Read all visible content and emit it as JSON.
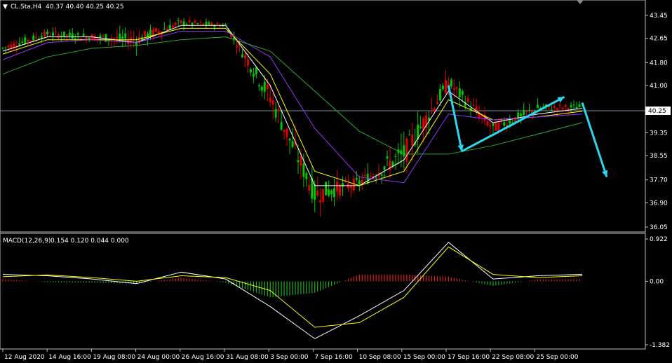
{
  "header": {
    "symbol": "CL.Sta,H4",
    "ohlc": "40.37 40.40 40.25 40.25",
    "macd_label": "MACD(12,26,9)",
    "macd_values": "0.154 0.120 0.044 0.000"
  },
  "price_axis": {
    "ticks": [
      "43.45",
      "42.65",
      "41.80",
      "41.00",
      "40.15",
      "39.35",
      "38.55",
      "37.70",
      "36.90",
      "36.05"
    ],
    "current_price_label": "40.25"
  },
  "macd_axis": {
    "ticks": [
      "0.922",
      "0.00",
      "-1.382"
    ]
  },
  "time_axis": {
    "labels": [
      "12 Aug 2020",
      "14 Aug 16:00",
      "19 Aug 08:00",
      "24 Aug 00:00",
      "26 Aug 16:00",
      "31 Aug 08:00",
      "3 Sep 00:00",
      "7 Sep 16:00",
      "10 Sep 08:00",
      "15 Sep 00:00",
      "17 Sep 16:00",
      "22 Sep 08:00",
      "25 Sep 00:00"
    ]
  },
  "colors": {
    "background": "#000000",
    "grid_border": "#c0c0c0",
    "bull_candle": "#00c800",
    "bear_candle": "#e00000",
    "ma_fast": "#ffffff",
    "ma_yellow": "#ffff00",
    "ma_purple": "#9933ff",
    "ma_slow": "#33aa33",
    "arrow": "#2ad8ee",
    "macd_hist_pos": "#e02020",
    "macd_hist_neg": "#20b020",
    "price_line": "#7f8fa6"
  },
  "chart_data": [
    {
      "type": "candlestick",
      "title": "CL.Sta,H4",
      "y_axis_range": [
        36.05,
        43.45
      ],
      "current_price": 40.25,
      "x": [
        "12 Aug 2020",
        "14 Aug 16:00",
        "19 Aug 08:00",
        "24 Aug 00:00",
        "26 Aug 16:00",
        "31 Aug 08:00",
        "3 Sep 00:00",
        "7 Sep 16:00",
        "10 Sep 08:00",
        "15 Sep 00:00",
        "17 Sep 16:00",
        "22 Sep 08:00",
        "25 Sep 00:00",
        "28 Sep"
      ],
      "close": [
        42.3,
        42.8,
        42.7,
        42.6,
        43.2,
        43.1,
        40.6,
        37.2,
        37.6,
        38.6,
        41.1,
        39.5,
        40.2,
        40.25
      ],
      "high": [
        42.8,
        43.1,
        43.0,
        43.2,
        43.6,
        43.3,
        42.0,
        39.2,
        38.3,
        40.3,
        41.6,
        40.4,
        40.6,
        40.7
      ],
      "low": [
        41.6,
        42.1,
        41.9,
        41.4,
        42.6,
        42.7,
        39.0,
        36.2,
        36.8,
        37.0,
        39.6,
        38.8,
        39.4,
        39.8
      ],
      "moving_averages": [
        {
          "name": "fast",
          "color": "#ffffff",
          "values": [
            42.2,
            42.7,
            42.7,
            42.5,
            43.1,
            43.1,
            41.0,
            37.5,
            37.5,
            38.4,
            40.8,
            39.7,
            40.0,
            40.2
          ]
        },
        {
          "name": "medium",
          "color": "#ffff00",
          "values": [
            42.1,
            42.6,
            42.6,
            42.6,
            43.0,
            43.0,
            41.4,
            38.0,
            37.5,
            38.0,
            40.5,
            39.8,
            39.9,
            40.1
          ]
        },
        {
          "name": "slow",
          "color": "#9933ff",
          "values": [
            41.9,
            42.5,
            42.6,
            42.5,
            42.9,
            42.9,
            42.0,
            39.5,
            37.8,
            37.6,
            40.0,
            39.8,
            39.9,
            40.0
          ]
        },
        {
          "name": "long",
          "color": "#33aa33",
          "values": [
            41.4,
            42.0,
            42.3,
            42.4,
            42.6,
            42.7,
            42.2,
            40.8,
            39.4,
            38.6,
            38.6,
            38.9,
            39.3,
            39.7
          ]
        }
      ],
      "annotations": [
        {
          "type": "arrow",
          "from": [
            "17 Sep 16:00",
            41.0
          ],
          "to": [
            "22 Sep 00:00",
            38.7
          ]
        },
        {
          "type": "arrow",
          "from": [
            "22 Sep 00:00",
            38.7
          ],
          "to": [
            "25 Sep 12:00",
            40.6
          ]
        },
        {
          "type": "arrow",
          "from": [
            "28 Sep",
            40.4
          ],
          "to": [
            "29 Sep",
            37.8
          ]
        }
      ]
    },
    {
      "type": "bar",
      "title": "MACD(12,26,9)",
      "y_axis_range": [
        -1.382,
        0.922
      ],
      "x": [
        "12 Aug 2020",
        "14 Aug 16:00",
        "19 Aug 08:00",
        "24 Aug 00:00",
        "26 Aug 16:00",
        "31 Aug 08:00",
        "3 Sep 00:00",
        "7 Sep 16:00",
        "10 Sep 08:00",
        "15 Sep 00:00",
        "17 Sep 16:00",
        "22 Sep 08:00",
        "25 Sep 00:00",
        "28 Sep"
      ],
      "series": [
        {
          "name": "MACD",
          "values": [
            0.15,
            0.12,
            0.05,
            -0.05,
            0.2,
            0.05,
            -0.55,
            -1.25,
            -0.75,
            -0.2,
            0.85,
            0.05,
            0.12,
            0.154
          ]
        },
        {
          "name": "Signal",
          "values": [
            0.1,
            0.14,
            0.08,
            0.0,
            0.12,
            0.08,
            -0.2,
            -1.0,
            -0.9,
            -0.35,
            0.75,
            0.15,
            0.08,
            0.12
          ]
        },
        {
          "name": "Histogram",
          "values": [
            0.05,
            -0.02,
            -0.03,
            -0.05,
            0.08,
            -0.03,
            -0.35,
            -0.25,
            0.15,
            0.15,
            0.1,
            -0.1,
            0.04,
            0.044
          ]
        }
      ]
    }
  ]
}
